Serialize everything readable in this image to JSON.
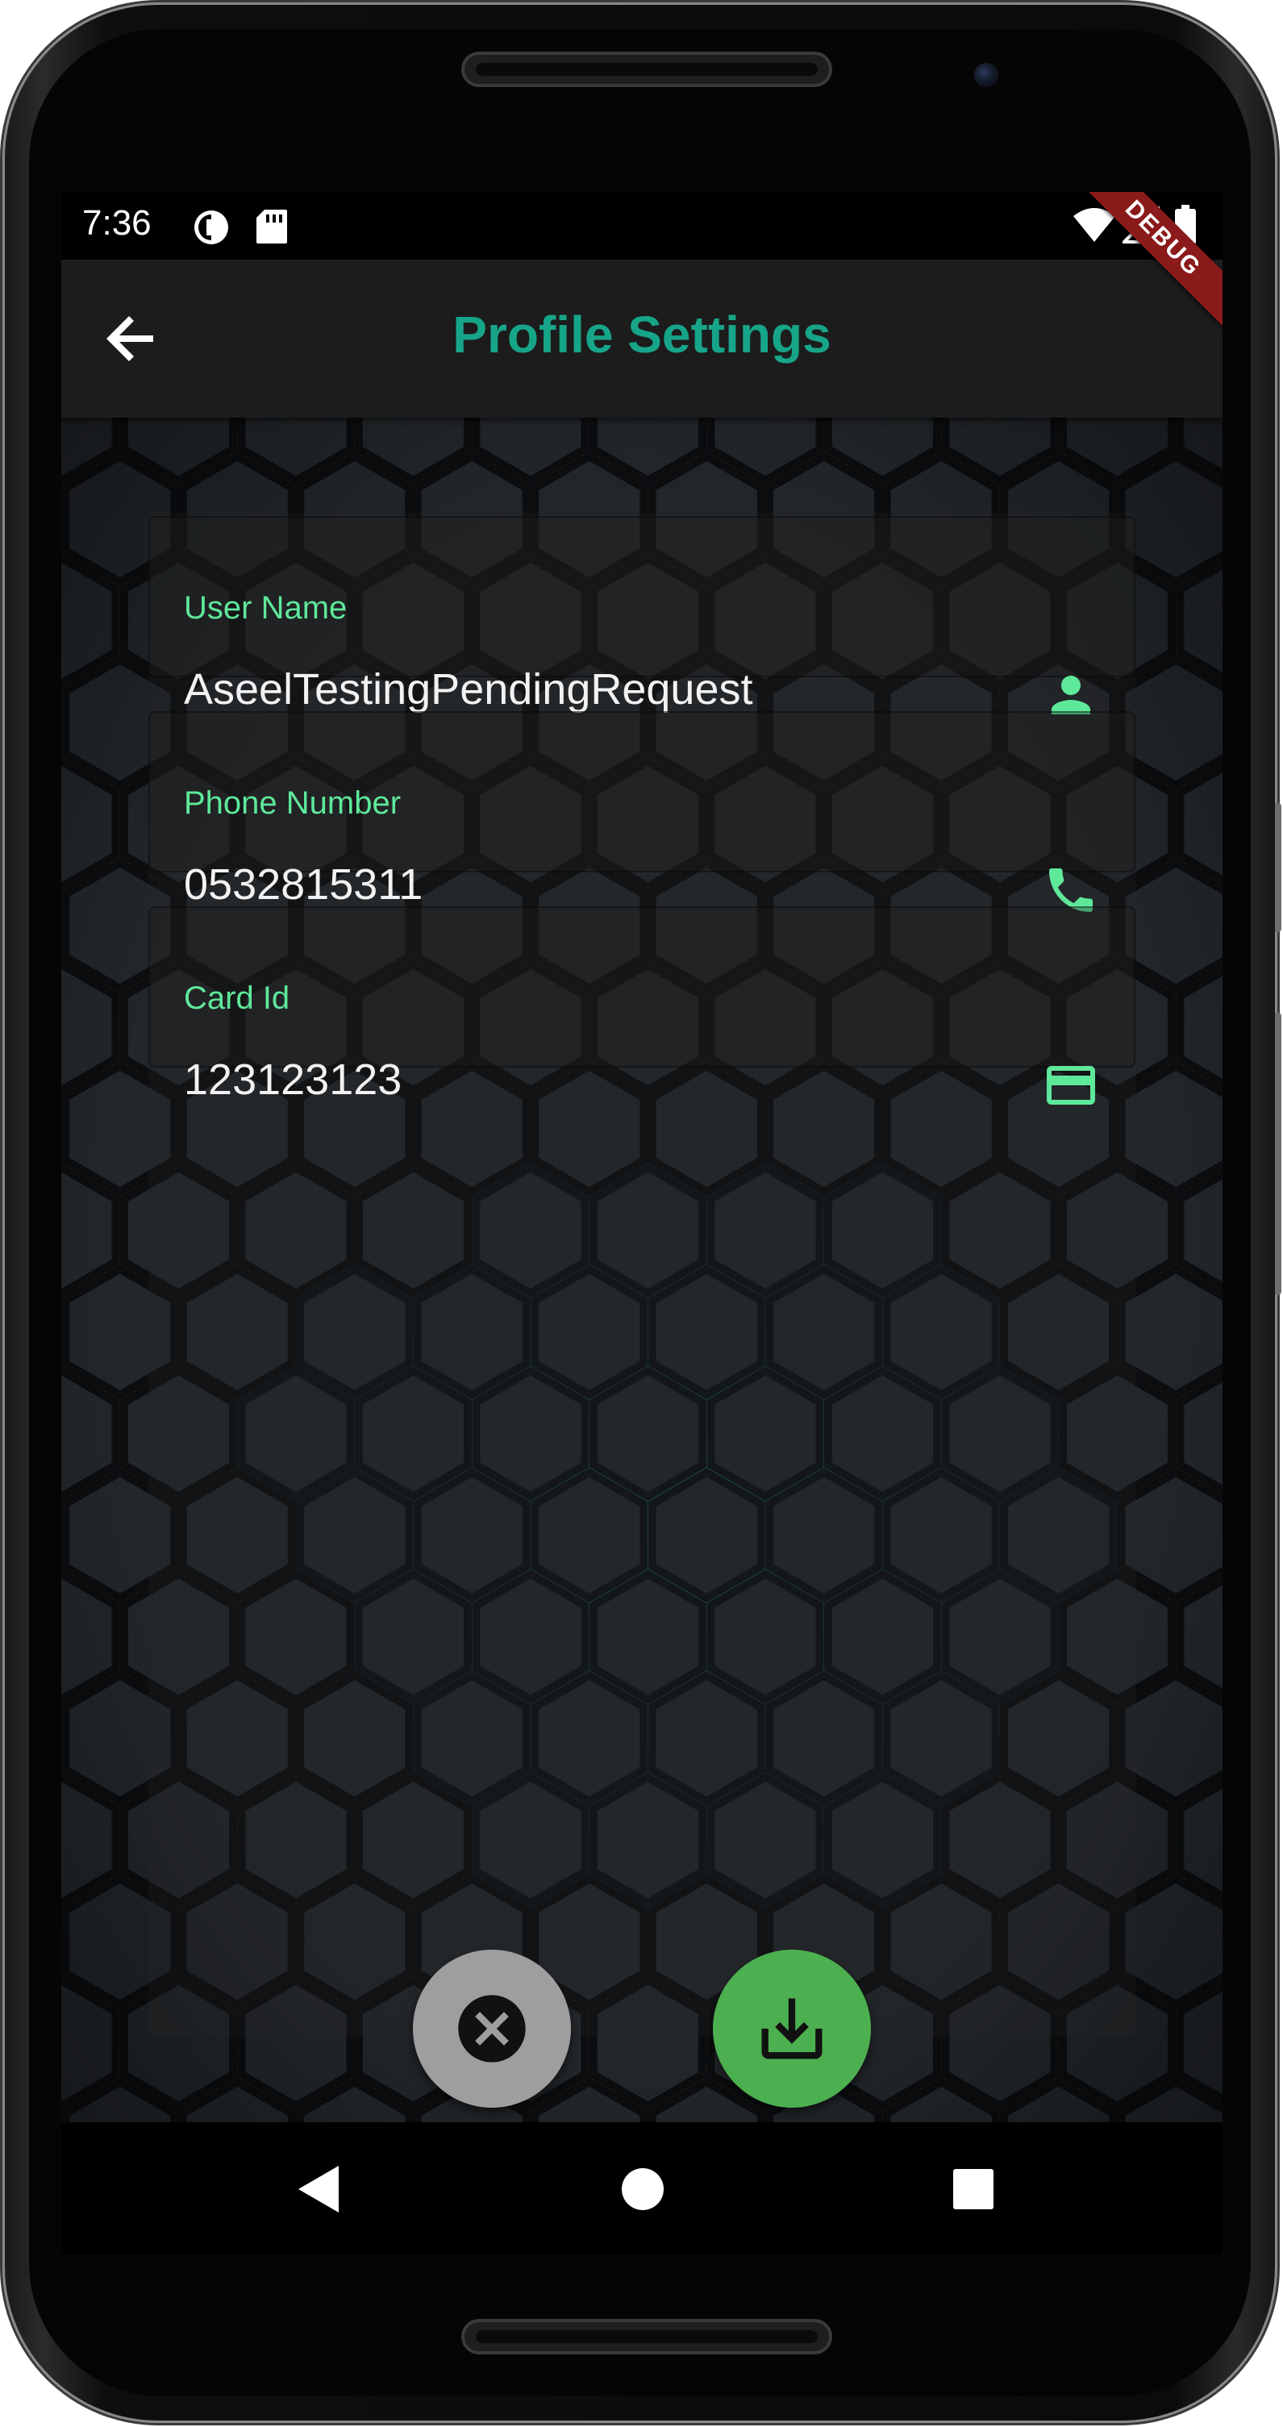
{
  "status_bar": {
    "time": "7:36",
    "left_icons": [
      "data-saver-icon",
      "sd-card-icon"
    ],
    "right_icons": [
      "wifi-icon",
      "signal-icon",
      "battery-icon"
    ]
  },
  "app_bar": {
    "title": "Profile Settings",
    "back_icon": "arrow-back-icon",
    "debug_banner": "DEBUG"
  },
  "form": {
    "fields": [
      {
        "label": "User Name",
        "value": "AseelTestingPendingRequest",
        "icon": "person-icon"
      },
      {
        "label": "Phone Number",
        "value": "0532815311",
        "icon": "phone-icon"
      },
      {
        "label": "Card Id",
        "value": "123123123",
        "icon": "credit-card-icon"
      }
    ]
  },
  "actions": {
    "cancel": {
      "icon": "cancel-circle-icon",
      "color": "#9e9e9e"
    },
    "save": {
      "icon": "download-icon",
      "color": "#4caf50"
    }
  },
  "navigation": {
    "buttons": [
      "back-triangle-icon",
      "home-circle-icon",
      "recents-square-icon"
    ]
  },
  "colors": {
    "accent_title": "#17a589",
    "label_green": "#5ee89a",
    "appbar_bg": "#1c1c1c",
    "debug_red": "#8b1a1a"
  }
}
